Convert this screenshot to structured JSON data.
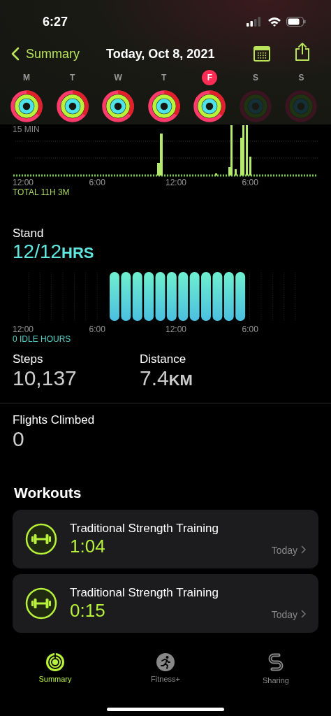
{
  "status_bar": {
    "time": "6:27"
  },
  "nav": {
    "back": "Summary",
    "title": "Today, Oct 8, 2021"
  },
  "week": [
    {
      "letter": "M",
      "selected": false,
      "active": true
    },
    {
      "letter": "T",
      "selected": false,
      "active": true
    },
    {
      "letter": "W",
      "selected": false,
      "active": true
    },
    {
      "letter": "T",
      "selected": false,
      "active": true
    },
    {
      "letter": "F",
      "selected": true,
      "active": true
    },
    {
      "letter": "S",
      "selected": false,
      "active": false
    },
    {
      "letter": "S",
      "selected": false,
      "active": false
    }
  ],
  "exercise": {
    "scale_label": "15 MIN",
    "x_labels": [
      "12:00",
      "6:00",
      "12:00",
      "6:00"
    ],
    "total": "TOTAL 11H 3M"
  },
  "stand": {
    "label": "Stand",
    "value": "12/12",
    "unit": "HRS",
    "x_labels": [
      "12:00",
      "6:00",
      "12:00",
      "6:00"
    ],
    "idle": "0 IDLE HOURS"
  },
  "stats": [
    {
      "label": "Steps",
      "value": "10,137"
    },
    {
      "label": "Distance",
      "value": "7.4",
      "unit": "KM"
    }
  ],
  "flights": {
    "label": "Flights Climbed",
    "value": "0"
  },
  "workouts_title": "Workouts",
  "workouts": [
    {
      "name": "Traditional Strength Training",
      "duration": "1:04",
      "when": "Today"
    },
    {
      "name": "Traditional Strength Training",
      "duration": "0:15",
      "when": "Today"
    }
  ],
  "tabs": [
    {
      "label": "Summary",
      "selected": true,
      "kind": "rings"
    },
    {
      "label": "Fitness+",
      "selected": false,
      "kind": "runner"
    },
    {
      "label": "Sharing",
      "selected": false,
      "kind": "sharing"
    }
  ]
}
